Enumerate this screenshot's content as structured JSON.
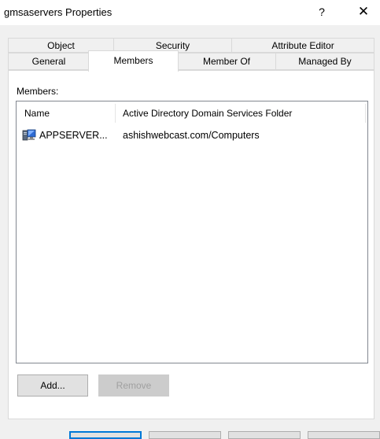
{
  "window": {
    "title": "gmsaservers Properties",
    "help_label": "?",
    "close_label": "✕"
  },
  "tabs": {
    "row1": [
      {
        "label": "Object"
      },
      {
        "label": "Security"
      },
      {
        "label": "Attribute Editor"
      }
    ],
    "row2": [
      {
        "label": "General"
      },
      {
        "label": "Members",
        "active": true
      },
      {
        "label": "Member Of"
      },
      {
        "label": "Managed By"
      }
    ]
  },
  "members": {
    "label": "Members:",
    "columns": [
      "Name",
      "Active Directory Domain Services Folder"
    ],
    "rows": [
      {
        "icon": "computer-icon",
        "name": "APPSERVER...",
        "folder": "ashishwebcast.com/Computers"
      }
    ]
  },
  "buttons": {
    "add": "Add...",
    "remove": "Remove"
  },
  "colors": {
    "accent": "#0078d7",
    "background": "#f0f0f0",
    "panel": "#ffffff"
  }
}
